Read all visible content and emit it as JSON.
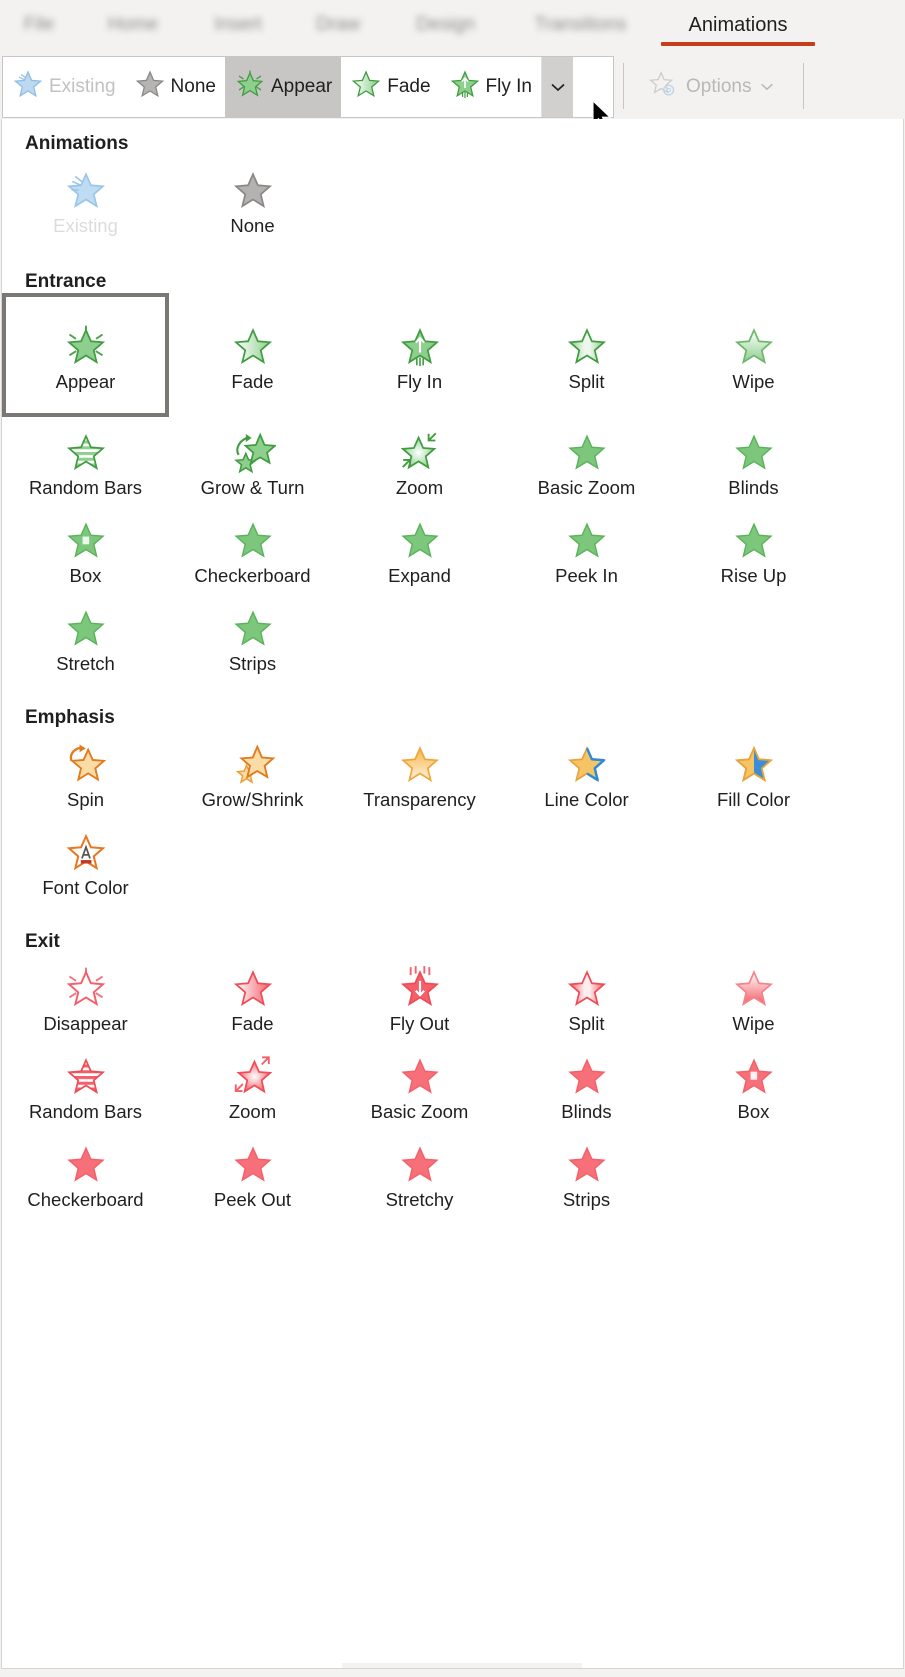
{
  "ribbon": {
    "tabs": [
      {
        "label": "File",
        "active": false,
        "blurred": true
      },
      {
        "label": "Home",
        "active": false,
        "blurred": true
      },
      {
        "label": "Insert",
        "active": false,
        "blurred": true
      },
      {
        "label": "Draw",
        "active": false,
        "blurred": true
      },
      {
        "label": "Design",
        "active": false,
        "blurred": true
      },
      {
        "label": "Transitions",
        "active": false,
        "blurred": true
      },
      {
        "label": "Animations",
        "active": true,
        "blurred": false
      }
    ],
    "accent_color": "#c43e1c",
    "gallery_items": [
      {
        "label": "Existing",
        "icon": "star-existing-icon",
        "state": "disabled"
      },
      {
        "label": "None",
        "icon": "star-none-icon",
        "state": "normal"
      },
      {
        "label": "Appear",
        "icon": "star-appear-icon",
        "state": "selected"
      },
      {
        "label": "Fade",
        "icon": "star-fade-icon",
        "state": "normal"
      },
      {
        "label": "Fly In",
        "icon": "star-flyin-icon",
        "state": "normal"
      }
    ],
    "more_button": {
      "icon": "chevron-down-icon",
      "state": "hovered"
    },
    "options_button": {
      "label": "Options",
      "icon": "star-gear-icon",
      "chevron": "chevron-down-icon",
      "state": "disabled"
    }
  },
  "panel": {
    "sections": [
      {
        "title": "Animations",
        "items": [
          {
            "label": "Existing",
            "icon": "star-existing-icon",
            "color": "#a9cbe8",
            "state": "disabled",
            "selected": false
          },
          {
            "label": "None",
            "icon": "star-none-icon",
            "color": "#b0aeac",
            "state": "normal",
            "selected": false
          }
        ]
      },
      {
        "title": "Entrance",
        "items": [
          {
            "label": "Appear",
            "icon": "star-appear-icon",
            "color": "#5eb25e",
            "state": "normal",
            "selected": true
          },
          {
            "label": "Fade",
            "icon": "star-fade-icon",
            "color": "#5eb25e",
            "state": "normal",
            "selected": false
          },
          {
            "label": "Fly In",
            "icon": "star-flyin-icon",
            "color": "#5eb25e",
            "state": "normal",
            "selected": false
          },
          {
            "label": "Split",
            "icon": "star-split-icon",
            "color": "#5eb25e",
            "state": "normal",
            "selected": false
          },
          {
            "label": "Wipe",
            "icon": "star-wipe-icon",
            "color": "#5eb25e",
            "state": "normal",
            "selected": false
          },
          {
            "label": "Random Bars",
            "icon": "star-randombars-icon",
            "color": "#5eb25e",
            "state": "normal",
            "selected": false
          },
          {
            "label": "Grow & Turn",
            "icon": "star-growturn-icon",
            "color": "#5eb25e",
            "state": "normal",
            "selected": false
          },
          {
            "label": "Zoom",
            "icon": "star-zoom-icon",
            "color": "#5eb25e",
            "state": "normal",
            "selected": false
          },
          {
            "label": "Basic Zoom",
            "icon": "star-solid-icon",
            "color": "#5eb25e",
            "state": "normal",
            "selected": false
          },
          {
            "label": "Blinds",
            "icon": "star-solid-icon",
            "color": "#5eb25e",
            "state": "normal",
            "selected": false
          },
          {
            "label": "Box",
            "icon": "star-box-icon",
            "color": "#5eb25e",
            "state": "normal",
            "selected": false
          },
          {
            "label": "Checkerboard",
            "icon": "star-solid-icon",
            "color": "#5eb25e",
            "state": "normal",
            "selected": false
          },
          {
            "label": "Expand",
            "icon": "star-solid-icon",
            "color": "#5eb25e",
            "state": "normal",
            "selected": false
          },
          {
            "label": "Peek In",
            "icon": "star-solid-icon",
            "color": "#5eb25e",
            "state": "normal",
            "selected": false
          },
          {
            "label": "Rise Up",
            "icon": "star-solid-icon",
            "color": "#5eb25e",
            "state": "normal",
            "selected": false
          },
          {
            "label": "Stretch",
            "icon": "star-solid-icon",
            "color": "#5eb25e",
            "state": "normal",
            "selected": false
          },
          {
            "label": "Strips",
            "icon": "star-solid-icon",
            "color": "#5eb25e",
            "state": "normal",
            "selected": false
          }
        ]
      },
      {
        "title": "Emphasis",
        "items": [
          {
            "label": "Spin",
            "icon": "star-spin-icon",
            "color": "#e8a33d",
            "state": "normal",
            "selected": false
          },
          {
            "label": "Grow/Shrink",
            "icon": "star-growshrink-icon",
            "color": "#e8a33d",
            "state": "normal",
            "selected": false
          },
          {
            "label": "Transparency",
            "icon": "star-transparency-icon",
            "color": "#e8a33d",
            "state": "normal",
            "selected": false
          },
          {
            "label": "Line Color",
            "icon": "star-linecolor-icon",
            "color": "#e8a33d",
            "state": "normal",
            "selected": false
          },
          {
            "label": "Fill Color",
            "icon": "star-fillcolor-icon",
            "color": "#e8a33d",
            "state": "normal",
            "selected": false
          },
          {
            "label": "Font Color",
            "icon": "star-fontcolor-icon",
            "color": "#e8781f",
            "state": "normal",
            "selected": false
          }
        ]
      },
      {
        "title": "Exit",
        "items": [
          {
            "label": "Disappear",
            "icon": "star-disappear-icon",
            "color": "#f4606a",
            "state": "normal",
            "selected": false
          },
          {
            "label": "Fade",
            "icon": "star-fade-icon",
            "color": "#f4606a",
            "state": "normal",
            "selected": false
          },
          {
            "label": "Fly Out",
            "icon": "star-flyout-icon",
            "color": "#f4606a",
            "state": "normal",
            "selected": false
          },
          {
            "label": "Split",
            "icon": "star-split-icon",
            "color": "#f4606a",
            "state": "normal",
            "selected": false
          },
          {
            "label": "Wipe",
            "icon": "star-wipe-icon",
            "color": "#f4606a",
            "state": "normal",
            "selected": false
          },
          {
            "label": "Random Bars",
            "icon": "star-randombars-icon",
            "color": "#f4606a",
            "state": "normal",
            "selected": false
          },
          {
            "label": "Zoom",
            "icon": "star-zoomout-icon",
            "color": "#f4606a",
            "state": "normal",
            "selected": false
          },
          {
            "label": "Basic Zoom",
            "icon": "star-solid-icon",
            "color": "#f4606a",
            "state": "normal",
            "selected": false
          },
          {
            "label": "Blinds",
            "icon": "star-solid-icon",
            "color": "#f4606a",
            "state": "normal",
            "selected": false
          },
          {
            "label": "Box",
            "icon": "star-box-icon",
            "color": "#f4606a",
            "state": "normal",
            "selected": false
          },
          {
            "label": "Checkerboard",
            "icon": "star-solid-icon",
            "color": "#f4606a",
            "state": "normal",
            "selected": false
          },
          {
            "label": "Peek Out",
            "icon": "star-solid-icon",
            "color": "#f4606a",
            "state": "normal",
            "selected": false
          },
          {
            "label": "Stretchy",
            "icon": "star-solid-icon",
            "color": "#f4606a",
            "state": "normal",
            "selected": false
          },
          {
            "label": "Strips",
            "icon": "star-solid-icon",
            "color": "#f4606a",
            "state": "normal",
            "selected": false
          }
        ]
      }
    ]
  }
}
